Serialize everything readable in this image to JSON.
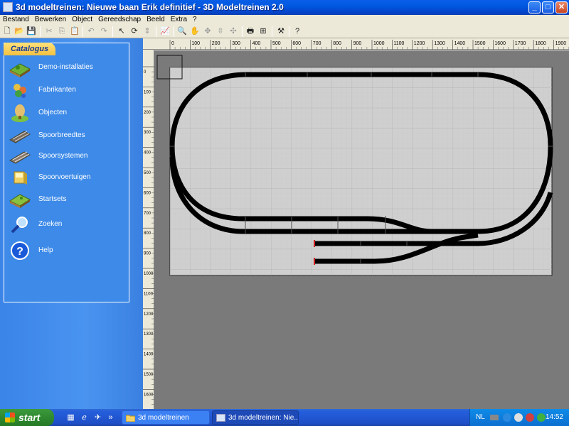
{
  "window": {
    "title": "3d modeltreinen: Nieuwe baan Erik definitief - 3D Modeltreinen 2.0",
    "controls": {
      "minimize": "_",
      "maximize": "□",
      "close": "✕"
    }
  },
  "menu": [
    "Bestand",
    "Bewerken",
    "Object",
    "Gereedschap",
    "Beeld",
    "Extra",
    "?"
  ],
  "toolbar": {
    "icons": [
      "new-icon",
      "open-icon",
      "save-icon",
      "cut-icon",
      "copy-icon",
      "paste-icon",
      "undo-icon",
      "redo-icon",
      "select-arrow-icon",
      "rotate-icon",
      "move-vertical-icon",
      "measure-icon",
      "zoom-icon",
      "hand-pan-icon",
      "move-horizontal-icon",
      "move-up-down-icon",
      "move-all-icon",
      "print-icon",
      "view-icon",
      "tools-icon",
      "help-icon"
    ]
  },
  "catalogus": {
    "header": "Catalogus",
    "items": [
      {
        "label": "Demo-installaties",
        "icon": "landscape-icon"
      },
      {
        "label": "Fabrikanten",
        "icon": "factory-icon"
      },
      {
        "label": "Objecten",
        "icon": "tree-icon"
      },
      {
        "label": "Spoorbreedtes",
        "icon": "track-icon"
      },
      {
        "label": "Spoorsystemen",
        "icon": "track-system-icon"
      },
      {
        "label": "Spoorvoertuigen",
        "icon": "wagon-icon"
      },
      {
        "label": "Startsets",
        "icon": "startset-icon"
      },
      {
        "label": "Zoeken",
        "icon": "search-icon"
      },
      {
        "label": "Help",
        "icon": "help-icon"
      }
    ]
  },
  "ruler": {
    "top": [
      "0",
      "100",
      "200",
      "300",
      "400",
      "500",
      "600",
      "700",
      "800",
      "900",
      "1000",
      "1100",
      "1200",
      "1300",
      "1400",
      "1500",
      "1600",
      "1700",
      "1800",
      "1900"
    ],
    "left": [
      "0",
      "100",
      "200",
      "300",
      "400",
      "500",
      "600",
      "700",
      "800",
      "900",
      "1000",
      "1100",
      "1200",
      "1300",
      "1400",
      "1500",
      "1600"
    ]
  },
  "taskbar": {
    "start": "start",
    "tasks": [
      {
        "label": "3d modeltreinen",
        "state": "inactive"
      },
      {
        "label": "3d modeltreinen: Nie...",
        "state": "active"
      }
    ],
    "tray": {
      "lang": "NL",
      "clock": "14:52"
    }
  },
  "colors": {
    "titlebar": "#0054e3",
    "canvas_bg": "#7a7a7a",
    "board_bg": "#cfcfcf",
    "track": "#000000",
    "taskbar": "#245edb",
    "start": "#3c9a3c"
  }
}
